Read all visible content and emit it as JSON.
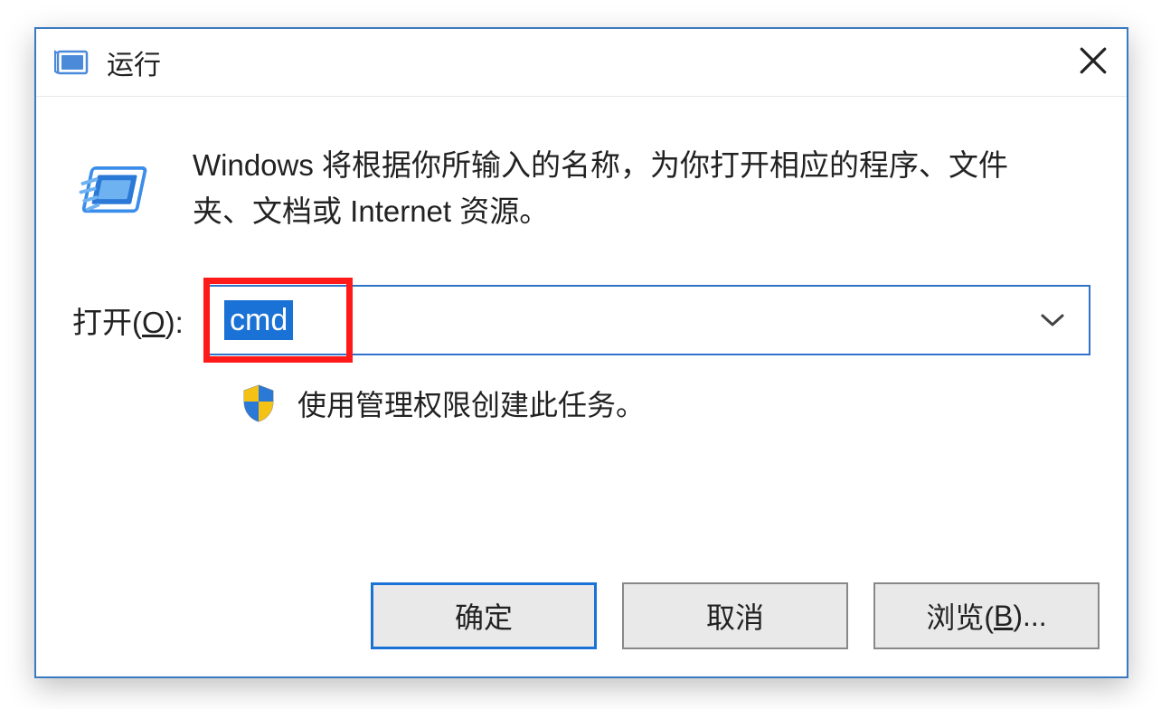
{
  "titlebar": {
    "title": "运行"
  },
  "content": {
    "description": "Windows 将根据你所输入的名称，为你打开相应的程序、文件夹、文档或 Internet 资源。",
    "open_label_prefix": "打开(",
    "open_label_key": "O",
    "open_label_suffix": "):",
    "input_value": "cmd",
    "admin_text": "使用管理权限创建此任务。"
  },
  "buttons": {
    "ok": "确定",
    "cancel": "取消",
    "browse_prefix": "浏览(",
    "browse_key": "B",
    "browse_suffix": ")..."
  },
  "colors": {
    "accent": "#1a72d6",
    "highlight": "#ff1a1a"
  }
}
